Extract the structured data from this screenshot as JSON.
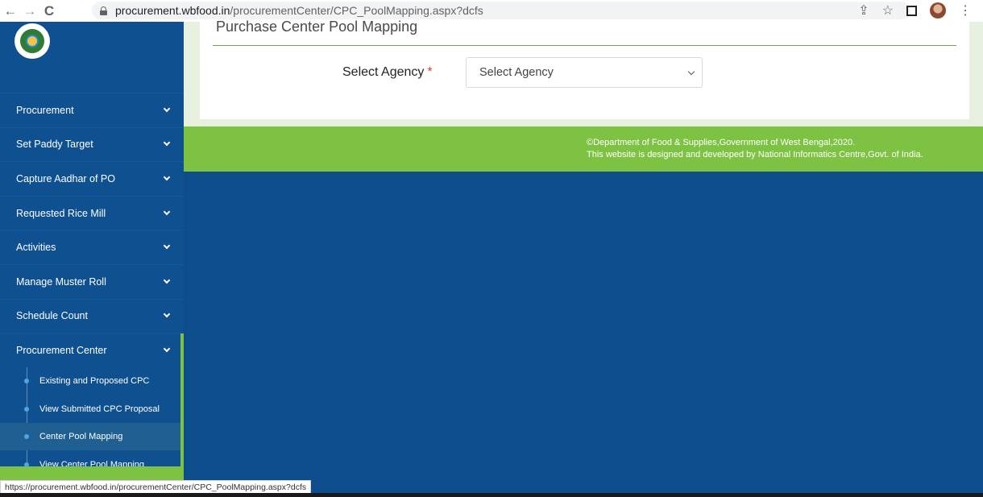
{
  "browser": {
    "url_host": "procurement.wbfood.in",
    "url_path": "/procurementCenter/CPC_PoolMapping.aspx?dcfs",
    "back_icon": "←",
    "forward_icon": "→",
    "reload_icon": "C",
    "share_icon": "⇪",
    "star_icon": "☆",
    "menu_icon": "⋮"
  },
  "sidebar": {
    "items": [
      {
        "label": "Procurement"
      },
      {
        "label": "Set Paddy Target"
      },
      {
        "label": "Capture Aadhar of PO"
      },
      {
        "label": "Requested Rice Mill"
      },
      {
        "label": "Activities"
      },
      {
        "label": "Manage Muster Roll"
      },
      {
        "label": "Schedule Count"
      },
      {
        "label": "Procurement Center"
      }
    ],
    "submenu": [
      {
        "label": "Existing and Proposed CPC"
      },
      {
        "label": "View Submitted CPC Proposal"
      },
      {
        "label": "Center Pool Mapping"
      },
      {
        "label": "View Center Pool Mapping"
      }
    ]
  },
  "main": {
    "title": "Purchase Center Pool Mapping",
    "select_label": "Select Agency",
    "required_mark": "*",
    "select_value": "Select Agency"
  },
  "footer": {
    "line1": "©Department of Food & Supplies,Government of West Bengal,2020.",
    "line2": "This website is designed and developed by National Informatics Centre,Govt. of India."
  },
  "status_bar": {
    "url": "https://procurement.wbfood.in/procurementCenter/CPC_PoolMapping.aspx?dcfs"
  },
  "colors": {
    "sidebar": "#0f5190",
    "accent_green": "#7dc242",
    "background": "#0e4d8c"
  }
}
